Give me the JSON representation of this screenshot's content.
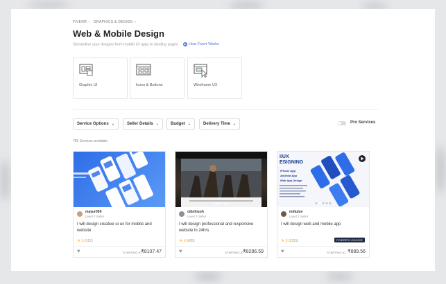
{
  "breadcrumb": [
    "FIVERR",
    "GRAPHICS & DESIGN"
  ],
  "page": {
    "title": "Web & Mobile Design",
    "subtitle": "Streamline your designs from mobile UI apps to landing pages",
    "how_link": "How Fiverr Works"
  },
  "categories": [
    {
      "label": "Graphic UI",
      "icon": "app-screens-icon"
    },
    {
      "label": "Icons & Buttons",
      "icon": "icons-grid-icon"
    },
    {
      "label": "Wireframe UX",
      "icon": "wireframe-cursor-icon"
    }
  ],
  "filters": [
    {
      "label": "Service Options"
    },
    {
      "label": "Seller Details"
    },
    {
      "label": "Budget"
    },
    {
      "label": "Delivery Time"
    }
  ],
  "pro_services_label": "Pro Services",
  "services_count": "782 Services available",
  "gigs": [
    {
      "seller": "mayur059",
      "level": "Level 2 Seller",
      "title": "I will design creative ui ux for mobile and website",
      "rating": "5.0",
      "reviews": "(12)",
      "starting_label": "STARTING AT",
      "price": "₹8107.47",
      "thumb_label": "",
      "badge": ""
    },
    {
      "seller": "citinfosoh",
      "level": "Level 2 Seller",
      "title": "I will design professional and responsive website in 24hrs",
      "rating": "4.9",
      "reviews": "(65)",
      "starting_label": "STARTING AT",
      "price": "₹8286.59",
      "thumb_label": "",
      "badge": ""
    },
    {
      "seller": "mdtuluv",
      "level": "Level 2 Seller",
      "title": "I will design web and mobile app",
      "rating": "5.0",
      "reviews": "(311)",
      "starting_label": "STARTING AT",
      "price": "₹889.56",
      "thumb_label": "I/UX\nESIGNING",
      "thumb_list": [
        "iPhone App",
        "Android App",
        "Web App Design"
      ],
      "badge": "FIVERR'S CHOICE"
    }
  ],
  "colors": {
    "accent": "#446ee7",
    "star": "#ffbe5b",
    "badge": "#1e2b47"
  }
}
